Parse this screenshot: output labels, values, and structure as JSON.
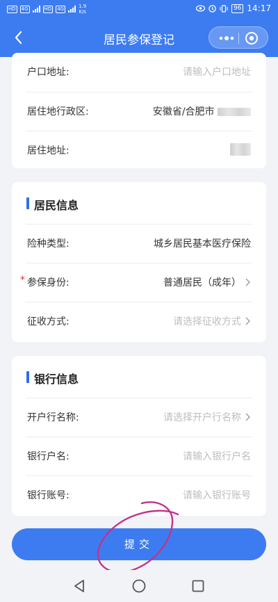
{
  "status_bar": {
    "sim1": "HD",
    "sim2": "HD",
    "net1": "4G",
    "net2": "4G",
    "speed_value": "1.9",
    "speed_unit": "K/s",
    "battery": "96",
    "time": "14:17"
  },
  "nav": {
    "title": "居民参保登记"
  },
  "address_section": {
    "rows": [
      {
        "label": "户口地址:",
        "placeholder": "请输入户口地址"
      },
      {
        "label": "居住地行政区:",
        "value": "安徽省/合肥市"
      },
      {
        "label": "居住地址:"
      }
    ]
  },
  "resident_section": {
    "title": "居民信息",
    "rows": [
      {
        "label": "险种类型:",
        "value": "城乡居民基本医疗保险"
      },
      {
        "label": "参保身份:",
        "value": "普通居民（成年）",
        "required_mark": "*"
      },
      {
        "label": "征收方式:",
        "placeholder": "请选择征收方式"
      }
    ]
  },
  "bank_section": {
    "title": "银行信息",
    "rows": [
      {
        "label": "开户行名称:",
        "placeholder": "请选择开户行名称"
      },
      {
        "label": "银行户名:",
        "placeholder": "请输入银行户名"
      },
      {
        "label": "银行账号:",
        "placeholder": "请输入银行账号"
      }
    ]
  },
  "submit_label": "提交",
  "colors": {
    "primary": "#3d7cf0",
    "required": "#e5322d",
    "annotation": "#c2338a"
  }
}
